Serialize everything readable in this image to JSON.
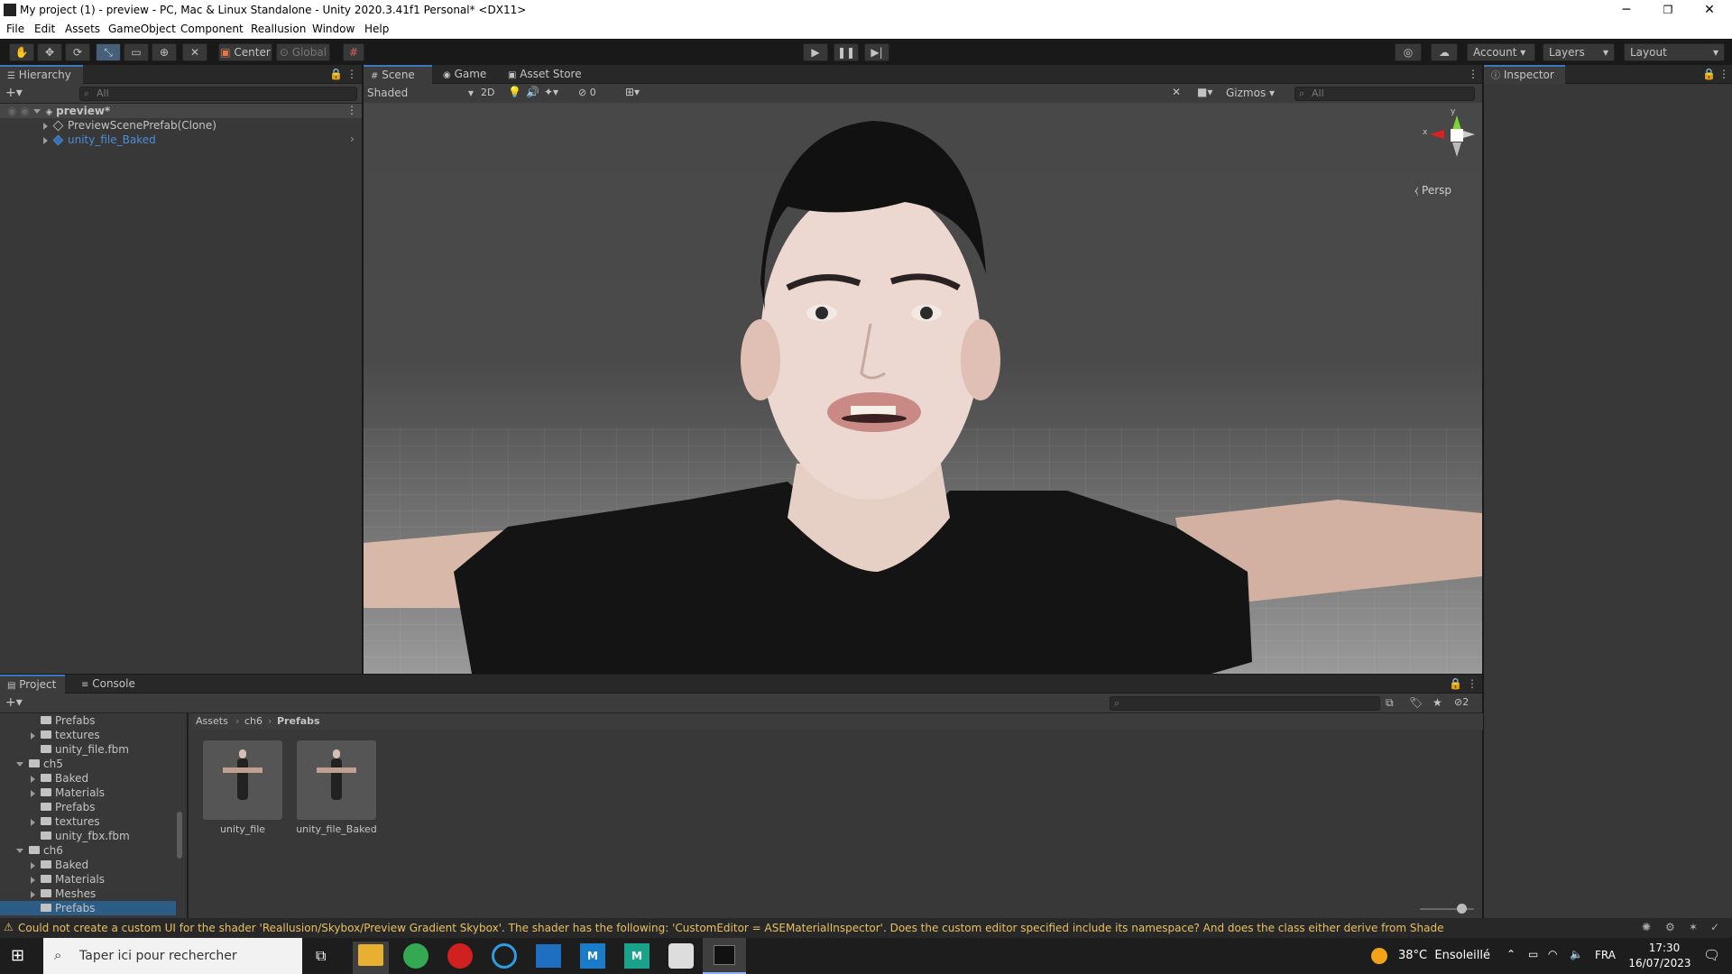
{
  "window": {
    "title": "My project (1) - preview - PC, Mac & Linux Standalone - Unity 2020.3.41f1 Personal* <DX11>",
    "controls": [
      "─",
      "❐",
      "✕"
    ]
  },
  "menu": [
    "File",
    "Edit",
    "Assets",
    "GameObject",
    "Component",
    "Reallusion",
    "Window",
    "Help"
  ],
  "toolbar": {
    "tools": [
      "hand-tool",
      "move-tool",
      "rotate-tool",
      "scale-tool",
      "rect-tool",
      "transform-tool",
      "custom-tool"
    ],
    "pivot_label": "Center",
    "space_label": "Global",
    "account_label": "Account",
    "layers_label": "Layers",
    "layout_label": "Layout"
  },
  "hierarchy": {
    "tab_label": "Hierarchy",
    "search_placeholder": "All",
    "rows": [
      {
        "label": "preview*"
      },
      {
        "label": "PreviewScenePrefab(Clone)"
      },
      {
        "label": "unity_file_Baked"
      }
    ]
  },
  "scene": {
    "tabs": [
      "Scene",
      "Game",
      "Asset Store"
    ],
    "shading_mode": "Shaded",
    "mode_2d": "2D",
    "hidden_count": "0",
    "gizmos_label": "Gizmos",
    "search_placeholder": "All",
    "gizmo": {
      "x": "x",
      "y": "y",
      "projection": "Persp"
    }
  },
  "inspector": {
    "tab_label": "Inspector"
  },
  "project": {
    "tabs": [
      "Project",
      "Console"
    ],
    "hidden_count": "2",
    "breadcrumb": [
      "Assets",
      "ch6",
      "Prefabs"
    ],
    "tree": [
      {
        "label": "Prefabs",
        "depth": 1,
        "folder": true,
        "expandable": false
      },
      {
        "label": "textures",
        "depth": 1,
        "folder": true,
        "expandable": true
      },
      {
        "label": "unity_file.fbm",
        "depth": 1,
        "folder": true,
        "expandable": false
      },
      {
        "label": "ch5",
        "depth": 0,
        "folder": true,
        "expandable": true,
        "open": true
      },
      {
        "label": "Baked",
        "depth": 1,
        "folder": true,
        "expandable": true
      },
      {
        "label": "Materials",
        "depth": 1,
        "folder": true,
        "expandable": true
      },
      {
        "label": "Prefabs",
        "depth": 1,
        "folder": true,
        "expandable": false
      },
      {
        "label": "textures",
        "depth": 1,
        "folder": true,
        "expandable": true
      },
      {
        "label": "unity_fbx.fbm",
        "depth": 1,
        "folder": true,
        "expandable": false
      },
      {
        "label": "ch6",
        "depth": 0,
        "folder": true,
        "expandable": true,
        "open": true
      },
      {
        "label": "Baked",
        "depth": 1,
        "folder": true,
        "expandable": true
      },
      {
        "label": "Materials",
        "depth": 1,
        "folder": true,
        "expandable": true
      },
      {
        "label": "Meshes",
        "depth": 1,
        "folder": true,
        "expandable": true
      },
      {
        "label": "Prefabs",
        "depth": 1,
        "folder": true,
        "expandable": false,
        "selected": true
      }
    ],
    "assets": [
      {
        "label": "unity_file"
      },
      {
        "label": "unity_file_Baked"
      }
    ]
  },
  "status": {
    "message": "Could not create a custom UI for the shader 'Reallusion/Skybox/Preview Gradient Skybox'. The shader has the following: 'CustomEditor = ASEMaterialInspector'. Does the custom editor specified include its namespace? And does the class either derive from ShaderGUI or MaterialEditor?"
  },
  "taskbar": {
    "search_placeholder": "Taper ici pour rechercher",
    "weather": "38°C  Ensoleillé",
    "language": "FRA",
    "time": "17:30",
    "date": "16/07/2023"
  },
  "colors": {
    "accent": "#3a79bb",
    "selection": "#2c5d87",
    "warning": "#e8c062",
    "link_blue": "#4c8ed9"
  }
}
